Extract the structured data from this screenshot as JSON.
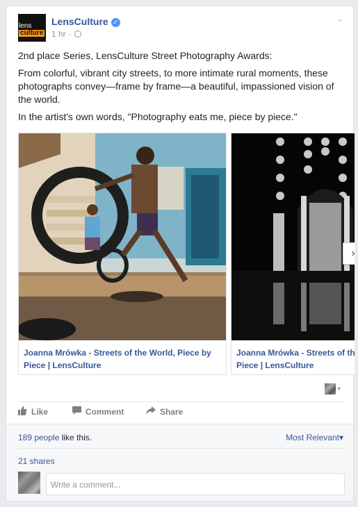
{
  "post": {
    "page_name": "LensCulture",
    "logo": {
      "line1": "lens",
      "line2": "culture"
    },
    "verified_badge": "✓",
    "timestamp": "1 hr",
    "separator": "·",
    "menu_caret": "⌄",
    "paragraphs": [
      "2nd place Series, LensCulture Street Photography Awards:",
      "From colorful, vibrant city streets, to more intimate rural moments, these photographs convey—frame by frame—a beautiful, impassioned vision of the world.",
      "In the artist's own words, \"Photography eats me, piece by piece.\""
    ]
  },
  "carousel": {
    "cards": [
      {
        "caption": "Joanna Mrówka - Streets of the World, Piece by Piece | LensCulture",
        "image": "boy-jumping-through-tire-photo"
      },
      {
        "caption": "Joanna Mrówka - Streets of the World, Piece by Piece | LensCulture",
        "image": "mosque-arch-reflection-photo"
      }
    ],
    "next_arrow": "›"
  },
  "actor_selector": {
    "caret": "▾"
  },
  "actions": {
    "like": "Like",
    "comment": "Comment",
    "share": "Share"
  },
  "feedback": {
    "likes_count_link": "189 people",
    "likes_suffix": " like this.",
    "sort": "Most Relevant",
    "sort_caret": "▾",
    "shares": "21 shares",
    "comment_placeholder": "Write a comment..."
  },
  "colors": {
    "link": "#365899",
    "background": "#e9ebee",
    "verified": "#5890ff"
  }
}
